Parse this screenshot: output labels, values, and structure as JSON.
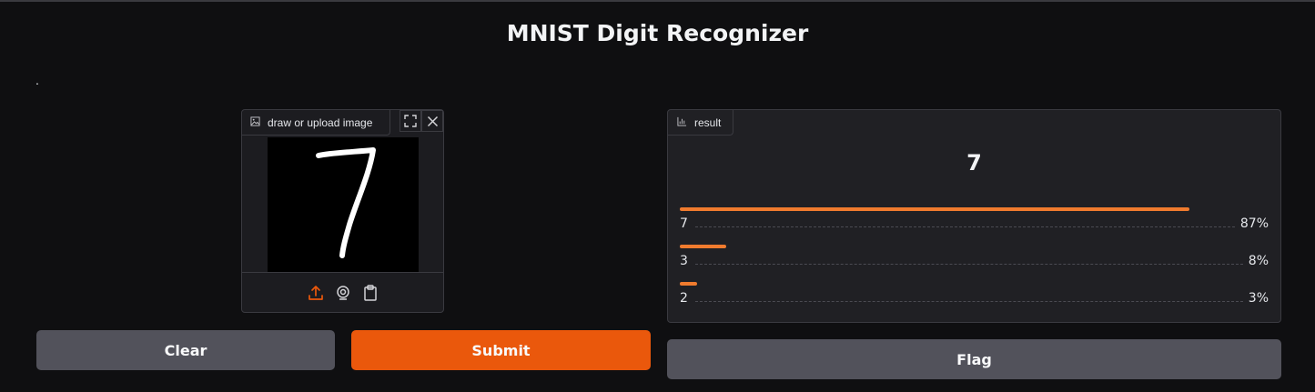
{
  "app": {
    "title": "MNIST Digit Recognizer",
    "description": "."
  },
  "input": {
    "label": "draw or upload image",
    "label_icon": "image-icon",
    "tools": [
      "fullscreen-icon",
      "close-icon"
    ],
    "sources": [
      "upload-icon",
      "webcam-icon",
      "clipboard-icon"
    ],
    "drawn_digit": "7"
  },
  "output": {
    "label": "result",
    "label_icon": "bar-chart-icon",
    "top_label": "7",
    "confidences": [
      {
        "label": "7",
        "value": 0.87,
        "text": "87%"
      },
      {
        "label": "3",
        "value": 0.08,
        "text": "8%"
      },
      {
        "label": "2",
        "value": 0.03,
        "text": "3%"
      }
    ],
    "bar_color": "#f07b2e"
  },
  "buttons": {
    "clear": "Clear",
    "submit": "Submit",
    "flag": "Flag"
  },
  "colors": {
    "accent": "#ea580c",
    "secondary": "#52525b",
    "background": "#0f0f11"
  }
}
